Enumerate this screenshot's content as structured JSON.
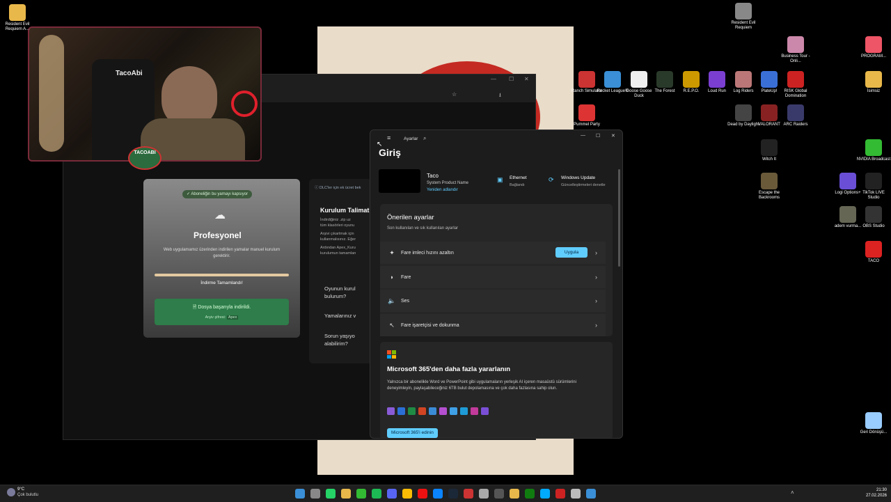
{
  "desktop": {
    "left_icons": [
      {
        "label": "Resident Evil Requiem A...",
        "icon": "folder-icon"
      }
    ],
    "right_icons": [
      {
        "label": "Resident Evil Requiem",
        "icon": "game-icon"
      },
      {
        "label": "Business Tour - Onli...",
        "icon": "game-icon"
      },
      {
        "label": "PROGRAM...",
        "icon": "folder-icon"
      },
      {
        "label": "Ranch Simulator",
        "icon": "game-icon"
      },
      {
        "label": "Rocket League®",
        "icon": "game-icon"
      },
      {
        "label": "Goose Goose Duck",
        "icon": "game-icon"
      },
      {
        "label": "The Forest",
        "icon": "game-icon"
      },
      {
        "label": "R.E.P.O.",
        "icon": "game-icon"
      },
      {
        "label": "Loud Run",
        "icon": "game-icon"
      },
      {
        "label": "Log Riders",
        "icon": "game-icon"
      },
      {
        "label": "PlateUp!",
        "icon": "game-icon"
      },
      {
        "label": "RISK Global Domination",
        "icon": "game-icon"
      },
      {
        "label": "İsimsiz",
        "icon": "folder-icon"
      },
      {
        "label": "Pummel Party",
        "icon": "game-icon"
      },
      {
        "label": "Dead by Daylight",
        "icon": "game-icon"
      },
      {
        "label": "VALORANT",
        "icon": "game-icon"
      },
      {
        "label": "ARC Raiders",
        "icon": "game-icon"
      },
      {
        "label": "Witch It",
        "icon": "game-icon"
      },
      {
        "label": "NVIDIA Broadcast",
        "icon": "app-icon"
      },
      {
        "label": "Escape the Backrooms",
        "icon": "game-icon"
      },
      {
        "label": "Logi Options+",
        "icon": "app-icon"
      },
      {
        "label": "TikTok LIVE Studio",
        "icon": "app-icon"
      },
      {
        "label": "adem vurma...",
        "icon": "image-icon"
      },
      {
        "label": "OBS Studio",
        "icon": "app-icon"
      },
      {
        "label": "TACO",
        "icon": "app-icon"
      },
      {
        "label": "Geri Dönüşü...",
        "icon": "recycle-bin-icon"
      }
    ]
  },
  "webcam": {
    "name_tag": "TACOABI",
    "shirt_text": "TacoAbi"
  },
  "patch_card": {
    "badge": "Aboneliğin bu yamayı kapsıyor",
    "brand": "Profesyonel",
    "description": "Web uygulamamız üzerinden indirilen yamalar manuel kurulum gerektirir.",
    "progress_label": "İndirme Tamamlandı!",
    "progress": 1.0,
    "success_title": "Dosya başarıyla indirildi.",
    "archive_password_label": "Arşiv şifresi:",
    "archive_password": "Apex"
  },
  "install_panel": {
    "notice": "DLC'ler için ek ücret bek",
    "title": "Kurulum Talimat",
    "lines": [
      "İndirdiğiniz .zip uz",
      "tüm klasörleri oyunu",
      "Arşivi çıkartmak için",
      "kullanmalısınız. Eğer",
      "Ardından Apex_Kuru",
      "kurulumun tamamlan"
    ],
    "faq": [
      {
        "q": "Oyunun kurul",
        "q2": "bulurum?"
      },
      {
        "q": "Yamalarınız v",
        "q2": ""
      },
      {
        "q": "Sorun yaşıyo",
        "q2": "alabilirim?"
      }
    ]
  },
  "settings": {
    "app_title": "Ayarlar",
    "page_title": "Giriş",
    "user_name": "Taco",
    "user_sub": "System Product Name",
    "rename_link": "Yeniden adlandır",
    "ethernet_title": "Ethernet",
    "ethernet_status": "Bağlandı",
    "wu_title": "Windows Update",
    "wu_status": "Güncelleştirmeleri denetle",
    "recommended_title": "Önerilen ayarlar",
    "recommended_sub": "Son kullanılan ve sık kullanılan ayarlar",
    "rows": [
      {
        "label": "Fare imleci hızını azaltın",
        "icon": "sparkle-icon"
      },
      {
        "label": "Fare",
        "icon": "mouse-icon"
      },
      {
        "label": "Ses",
        "icon": "speaker-icon"
      },
      {
        "label": "Fare işaretçisi ve dokunma",
        "icon": "pointer-icon"
      }
    ],
    "apply_label": "Uygula",
    "m365_title": "Microsoft 365'den daha fazla yararlanın",
    "m365_body": "Yalnızca bir abonelikle Word ve PowerPoint gibi uygulamaların yerleşik AI içeren masaüstü sürümlerini deneyimleyin, paylaşabileceğiniz 6TB bulut depolamasına ve çok daha fazlasına sahip olun.",
    "m365_button": "Microsoft 365'i edinin"
  },
  "taskbar": {
    "weather_temp": "9°C",
    "weather_desc": "Çok bulutlu",
    "time": "21:30",
    "date": "27.02.2026"
  },
  "colors": {
    "accent": "#60cdff",
    "success": "#2e7d4a",
    "progress": "#e3c9a0"
  }
}
